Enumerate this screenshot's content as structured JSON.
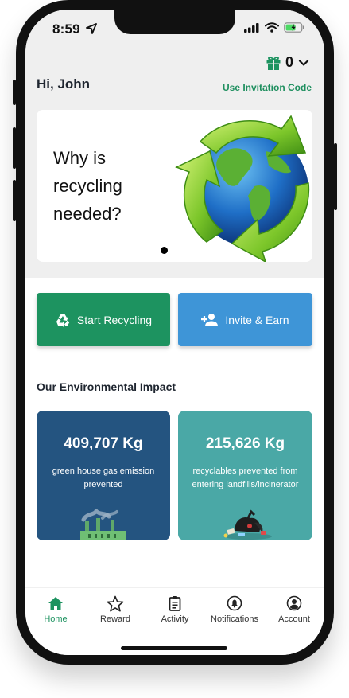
{
  "status_bar": {
    "time": "8:59"
  },
  "header": {
    "gift_count": "0",
    "greeting": "Hi, John",
    "invitation_link": "Use Invitation Code"
  },
  "banner": {
    "text": "Why is recycling needed?",
    "slide_count": 1,
    "active_slide": 1
  },
  "actions": {
    "start_recycling": "Start Recycling",
    "invite_earn": "Invite & Earn"
  },
  "impact": {
    "title": "Our Environmental Impact",
    "cards": [
      {
        "value": "409,707 Kg",
        "description": "green house gas emission prevented",
        "color": "#245480"
      },
      {
        "value": "215,626 Kg",
        "description": "recyclables prevented from entering landfills/incinerator",
        "color": "#4aa8a6"
      }
    ]
  },
  "tabs": [
    {
      "label": "Home",
      "icon": "home-icon",
      "active": true
    },
    {
      "label": "Reward",
      "icon": "star-icon",
      "active": false
    },
    {
      "label": "Activity",
      "icon": "clipboard-icon",
      "active": false
    },
    {
      "label": "Notifications",
      "icon": "bell-icon",
      "active": false
    },
    {
      "label": "Account",
      "icon": "account-icon",
      "active": false
    }
  ],
  "colors": {
    "brand_green": "#1d9360",
    "invite_blue": "#3e95d7",
    "card_dark_blue": "#245480",
    "card_teal": "#4aa8a6"
  }
}
